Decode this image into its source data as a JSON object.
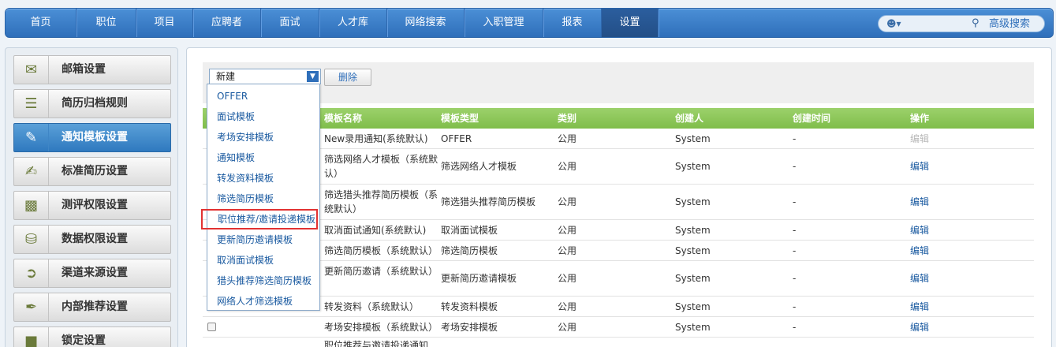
{
  "nav": {
    "items": [
      "首页",
      "职位",
      "项目",
      "应聘者",
      "面试",
      "人才库",
      "网络搜索",
      "入职管理",
      "报表",
      "设置"
    ],
    "active_index": 9,
    "advanced_search": "高级搜索"
  },
  "sidebar": {
    "items": [
      "邮箱设置",
      "简历归档规则",
      "通知模板设置",
      "标准简历设置",
      "测评权限设置",
      "数据权限设置",
      "渠道来源设置",
      "内部推荐设置",
      "锁定设置"
    ],
    "active_index": 2
  },
  "toolbar": {
    "select_value": "新建",
    "delete_label": "删除"
  },
  "dropdown": {
    "options": [
      "OFFER",
      "面试模板",
      "考场安排模板",
      "通知模板",
      "转发资料模板",
      "筛选简历模板",
      "职位推荐/邀请投递模板",
      "更新简历邀请模板",
      "取消面试模板",
      "猎头推荐筛选简历模板",
      "网络人才筛选模板"
    ],
    "highlighted_index": 6
  },
  "table": {
    "headers": [
      "模板名称",
      "模板类型",
      "类别",
      "创建人",
      "创建时间",
      "操作"
    ],
    "rows": [
      {
        "name": "New录用通知(系统默认)",
        "type": "OFFER",
        "category": "公用",
        "creator": "System",
        "time": "-",
        "action": "编辑",
        "disabled": true
      },
      {
        "name": "筛选网络人才模板（系统默认）",
        "type": "筛选网络人才模板",
        "category": "公用",
        "creator": "System",
        "time": "-",
        "action": "编辑"
      },
      {
        "name": "筛选猎头推荐简历模板（系统默认）",
        "type": "筛选猎头推荐简历模板",
        "category": "公用",
        "creator": "System",
        "time": "-",
        "action": "编辑"
      },
      {
        "name": "取消面试通知(系统默认)",
        "type": "取消面试模板",
        "category": "公用",
        "creator": "System",
        "time": "-",
        "action": "编辑"
      },
      {
        "name": "筛选简历模板（系统默认）",
        "type": "筛选简历模板",
        "category": "公用",
        "creator": "System",
        "time": "-",
        "action": "编辑"
      },
      {
        "name": "更新简历邀请（系统默认）",
        "type": "更新简历邀请模板",
        "category": "公用",
        "creator": "System",
        "time": "-",
        "action": "编辑"
      },
      {
        "name": "转发资料（系统默认）",
        "type": "转发资料模板",
        "category": "公用",
        "creator": "System",
        "time": "-",
        "action": "编辑"
      },
      {
        "name": "考场安排模板（系统默认）",
        "type": "考场安排模板",
        "category": "公用",
        "creator": "System",
        "time": "-",
        "action": "编辑"
      },
      {
        "name": "职位推荐与邀请投递通知",
        "type": "",
        "category": "",
        "creator": "",
        "time": "",
        "action": ""
      }
    ]
  },
  "colors": {
    "nav_blue": "#2f6fba",
    "header_green": "#8cc758",
    "highlight_red": "#e23232",
    "link_blue": "#1a5aa0"
  }
}
